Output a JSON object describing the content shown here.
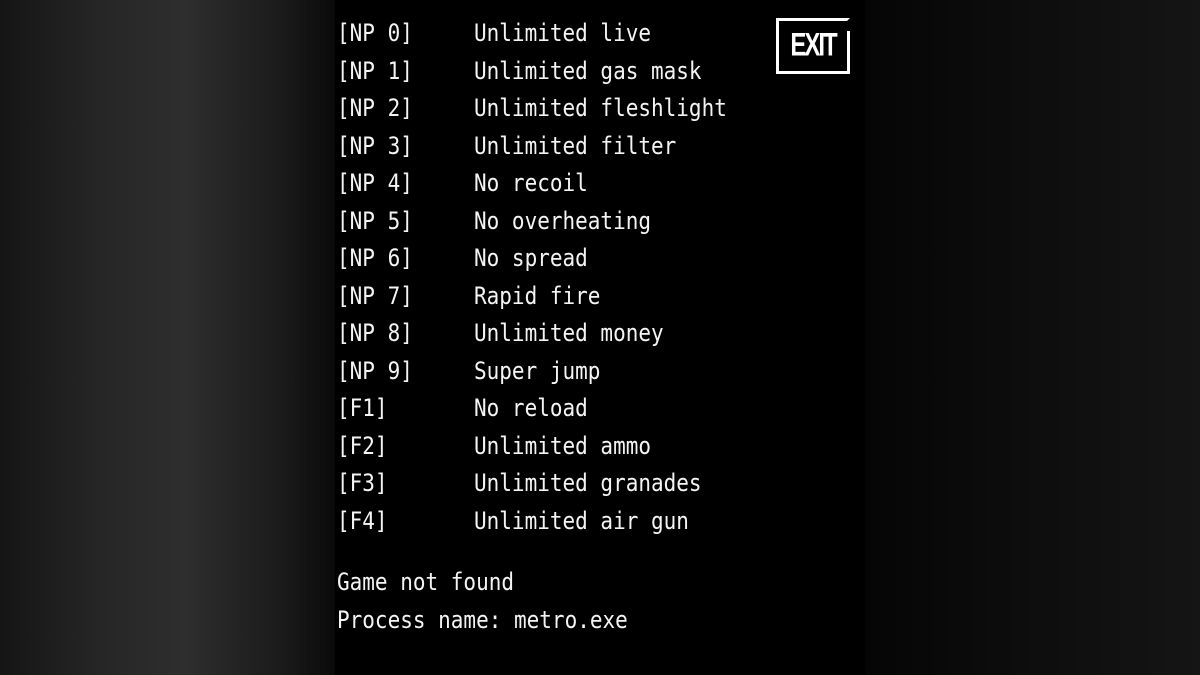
{
  "hotkeys": [
    {
      "key": "[NP 0]",
      "label": "Unlimited live"
    },
    {
      "key": "[NP 1]",
      "label": "Unlimited gas mask"
    },
    {
      "key": "[NP 2]",
      "label": "Unlimited fleshlight"
    },
    {
      "key": "[NP 3]",
      "label": "Unlimited filter"
    },
    {
      "key": "[NP 4]",
      "label": "No recoil"
    },
    {
      "key": "[NP 5]",
      "label": "No overheating"
    },
    {
      "key": "[NP 6]",
      "label": "No spread"
    },
    {
      "key": "[NP 7]",
      "label": "Rapid fire"
    },
    {
      "key": "[NP 8]",
      "label": "Unlimited money"
    },
    {
      "key": "[NP 9]",
      "label": "Super jump"
    },
    {
      "key": "[F1]",
      "label": "No reload"
    },
    {
      "key": "[F2]",
      "label": "Unlimited ammo"
    },
    {
      "key": "[F3]",
      "label": "Unlimited granades"
    },
    {
      "key": "[F4]",
      "label": "Unlimited air gun"
    }
  ],
  "status": {
    "game": "Game not found",
    "process": "Process name: metro.exe"
  },
  "exit_label": "EXIT"
}
